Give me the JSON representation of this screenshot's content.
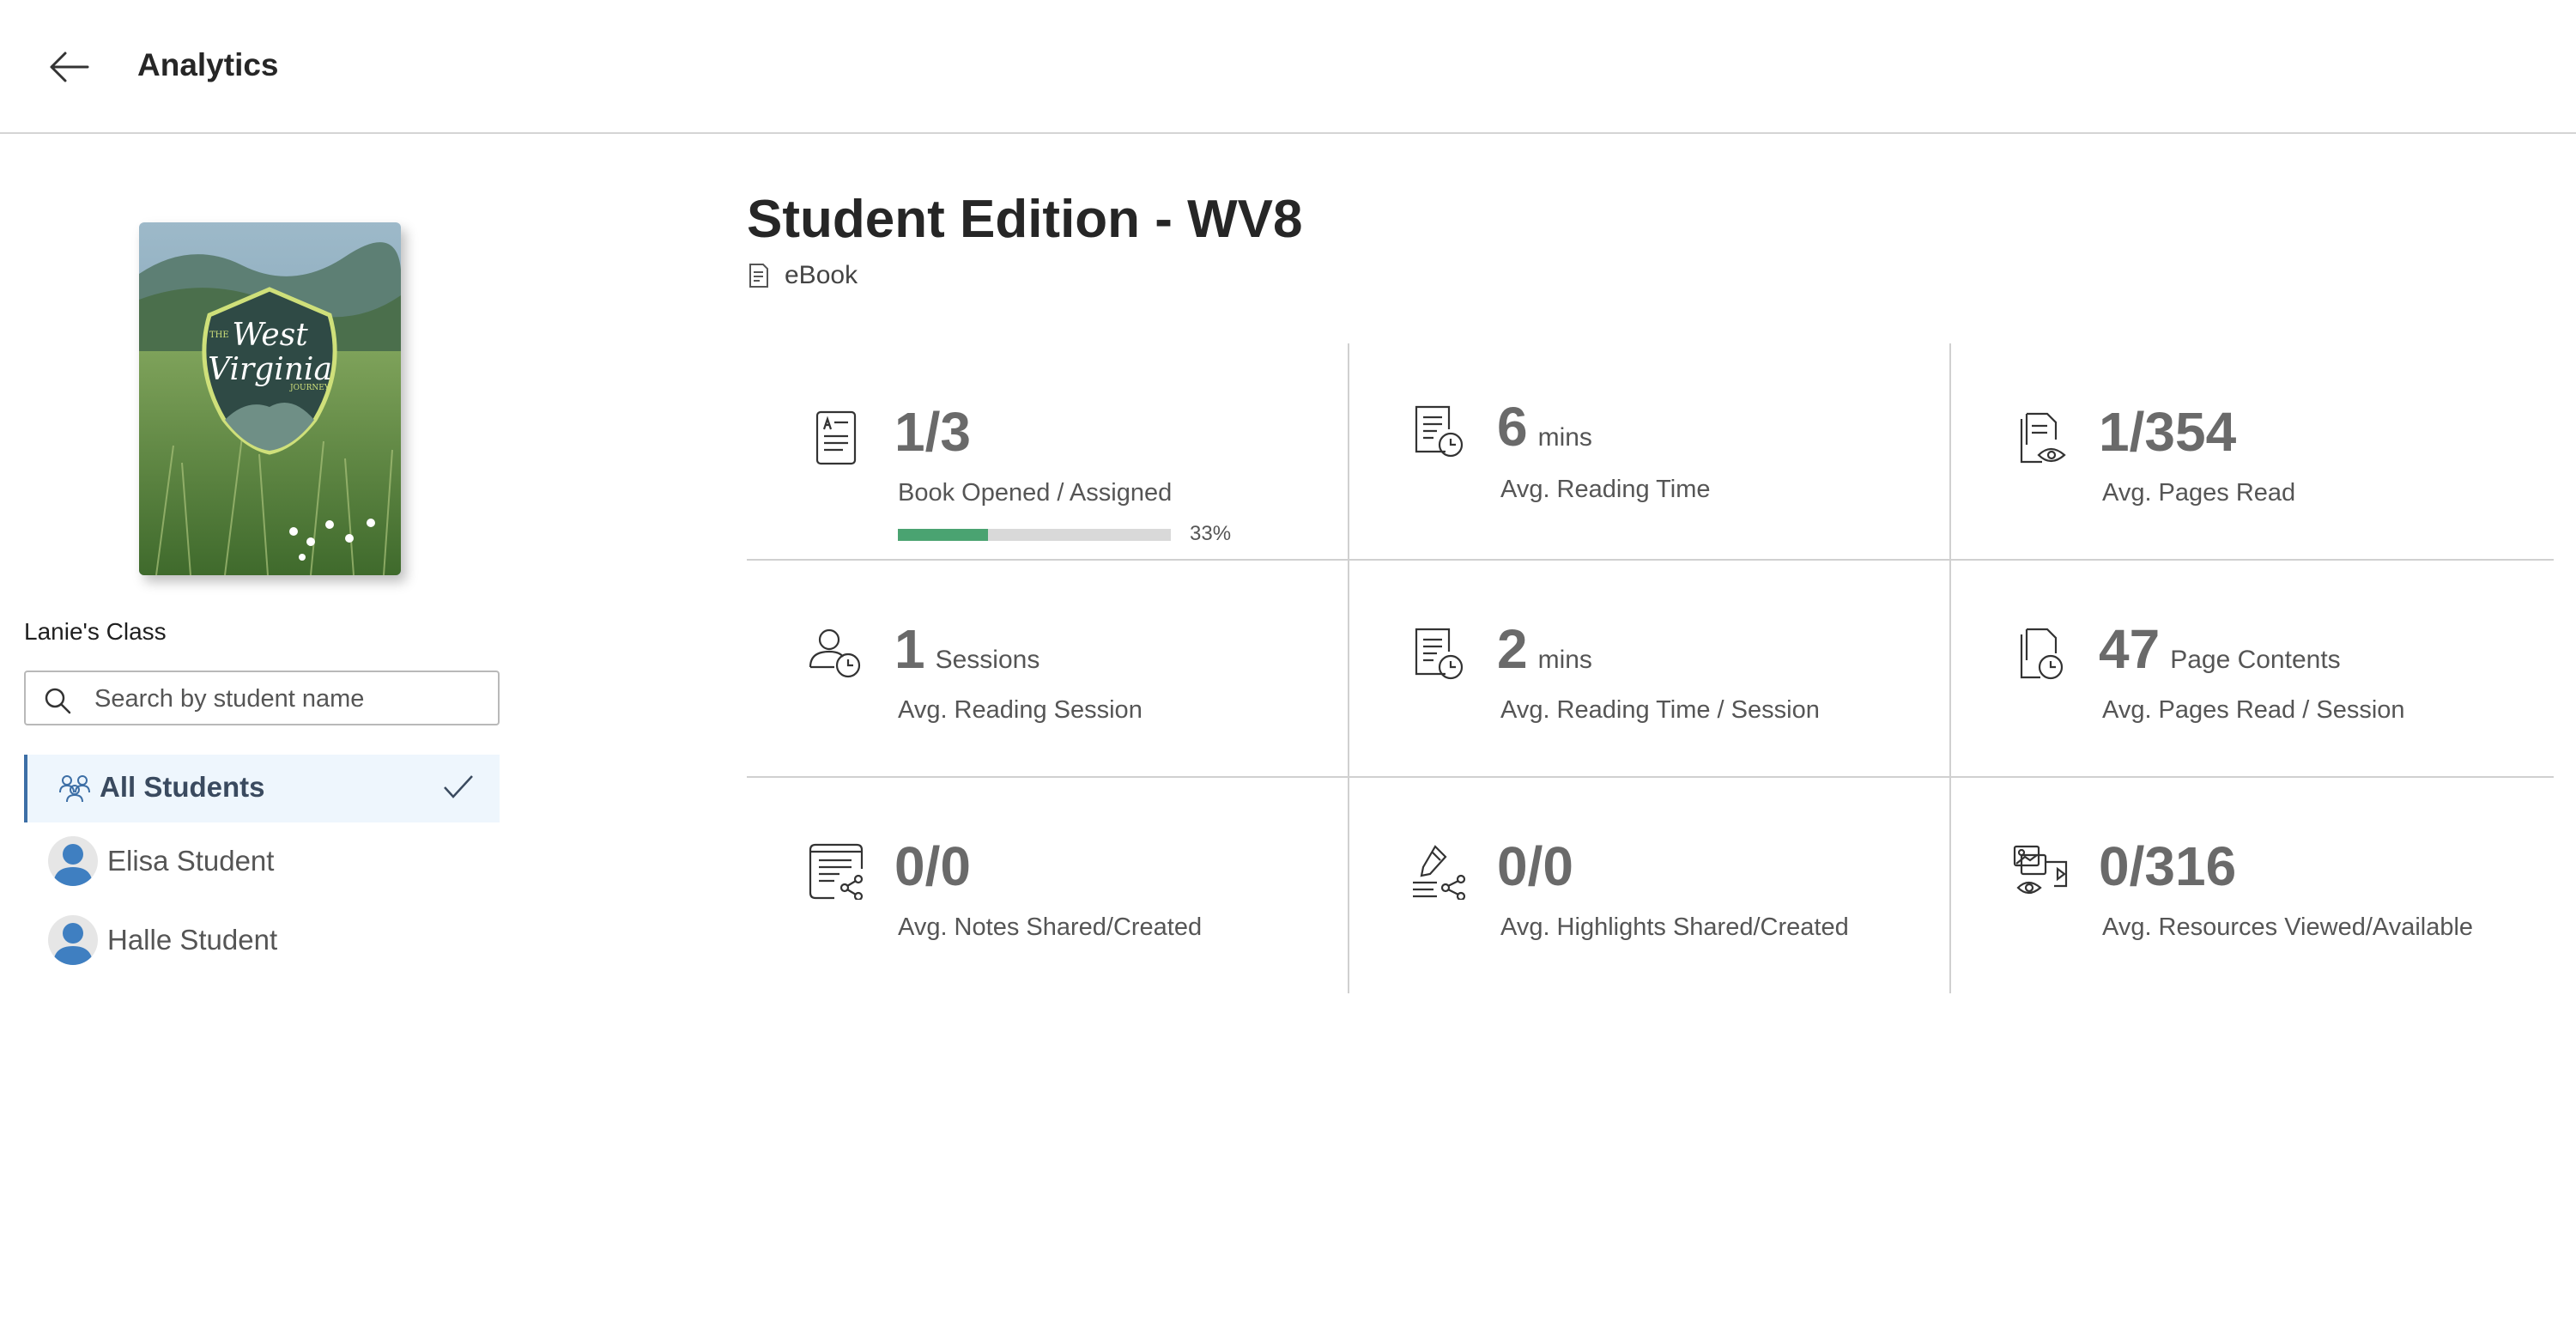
{
  "header": {
    "title": "Analytics",
    "back_icon": "arrow-left-icon"
  },
  "book": {
    "title": "Student Edition - WV8",
    "type": "eBook",
    "type_icon": "ebook-icon",
    "cover": {
      "prefix": "THE",
      "line1": "West",
      "line2": "Virginia",
      "suffix": "JOURNEY"
    }
  },
  "sidebar": {
    "class_name": "Lanie's Class",
    "search": {
      "placeholder": "Search by student name",
      "value": ""
    },
    "all_students": {
      "label": "All Students",
      "selected": true
    },
    "students": [
      {
        "name": "Elisa Student"
      },
      {
        "name": "Halle Student"
      }
    ]
  },
  "stats": [
    {
      "value": "1/3",
      "unit": "",
      "label": "Book Opened / Assigned",
      "icon": "document-list-icon",
      "progress": 0.33,
      "progress_label": "33%"
    },
    {
      "value": "6",
      "unit": "mins",
      "label": "Avg. Reading Time",
      "icon": "document-clock-icon"
    },
    {
      "value": "1/354",
      "unit": "",
      "label": "Avg. Pages Read",
      "icon": "pages-eye-icon"
    },
    {
      "value": "1",
      "unit": "Sessions",
      "label": "Avg. Reading Session",
      "icon": "user-clock-icon"
    },
    {
      "value": "2",
      "unit": "mins",
      "label": "Avg. Reading Time / Session",
      "icon": "document-clock-icon"
    },
    {
      "value": "47",
      "unit": "Page Contents",
      "label": "Avg. Pages Read / Session",
      "icon": "pages-clock-icon"
    },
    {
      "value": "0/0",
      "unit": "",
      "label": "Avg. Notes Shared/Created",
      "icon": "note-share-icon"
    },
    {
      "value": "0/0",
      "unit": "",
      "label": "Avg. Highlights Shared/Created",
      "icon": "highlighter-share-icon"
    },
    {
      "value": "0/316",
      "unit": "",
      "label": "Avg. Resources Viewed/Available",
      "icon": "resources-eye-icon"
    }
  ],
  "colors": {
    "accent": "#3d6fa6",
    "progress": "#4aa371",
    "selected_bg": "#eef6fd"
  }
}
